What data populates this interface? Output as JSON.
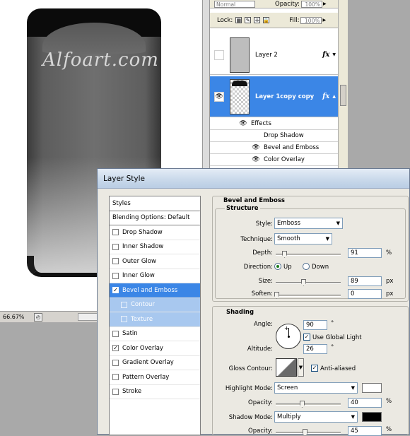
{
  "canvas": {
    "watermark": "Alfoart.com",
    "zoom": "66.67%"
  },
  "layers_panel": {
    "blend_mode": "Normal",
    "opacity_label": "Opacity:",
    "opacity_value": "100%",
    "lock_label": "Lock:",
    "fill_label": "Fill:",
    "fill_value": "100%",
    "layers": [
      {
        "name": "Layer 2",
        "visible": false,
        "fx": "fx"
      },
      {
        "name": "Layer 1copy copy",
        "visible": true,
        "fx": "fx",
        "selected": true
      }
    ],
    "effects_label": "Effects",
    "effects": [
      "Drop Shadow",
      "Bevel and Emboss",
      "Color Overlay"
    ]
  },
  "dialog": {
    "title": "Layer Style",
    "styles_header": "Styles",
    "blending_options": "Blending Options: Default",
    "styles": [
      {
        "label": "Drop Shadow",
        "checked": false
      },
      {
        "label": "Inner Shadow",
        "checked": false
      },
      {
        "label": "Outer Glow",
        "checked": false
      },
      {
        "label": "Inner Glow",
        "checked": false
      },
      {
        "label": "Bevel and Emboss",
        "checked": true,
        "selected": true
      },
      {
        "label": "Contour",
        "checked": false,
        "sub": true
      },
      {
        "label": "Texture",
        "checked": false,
        "sub": true
      },
      {
        "label": "Satin",
        "checked": false
      },
      {
        "label": "Color Overlay",
        "checked": true
      },
      {
        "label": "Gradient Overlay",
        "checked": false
      },
      {
        "label": "Pattern Overlay",
        "checked": false
      },
      {
        "label": "Stroke",
        "checked": false
      }
    ],
    "bevel": {
      "title": "Bevel and Emboss",
      "structure": {
        "legend": "Structure",
        "style_label": "Style:",
        "style_value": "Emboss",
        "technique_label": "Technique:",
        "technique_value": "Smooth",
        "depth_label": "Depth:",
        "depth_value": "91",
        "depth_unit": "%",
        "direction_label": "Direction:",
        "direction_up": "Up",
        "direction_down": "Down",
        "size_label": "Size:",
        "size_value": "89",
        "size_unit": "px",
        "soften_label": "Soften:",
        "soften_value": "0",
        "soften_unit": "px"
      },
      "shading": {
        "legend": "Shading",
        "angle_label": "Angle:",
        "angle_value": "90",
        "angle_unit": "°",
        "global_light_label": "Use Global Light",
        "altitude_label": "Altitude:",
        "altitude_value": "26",
        "altitude_unit": "°",
        "gloss_contour_label": "Gloss Contour:",
        "anti_aliased_label": "Anti-aliased",
        "highlight_mode_label": "Highlight Mode:",
        "highlight_mode_value": "Screen",
        "highlight_color": "#ffffff",
        "opacity_label": "Opacity:",
        "highlight_opacity": "40",
        "opacity_unit": "%",
        "shadow_mode_label": "Shadow Mode:",
        "shadow_mode_value": "Multiply",
        "shadow_color": "#000000",
        "shadow_opacity": "45"
      }
    }
  }
}
